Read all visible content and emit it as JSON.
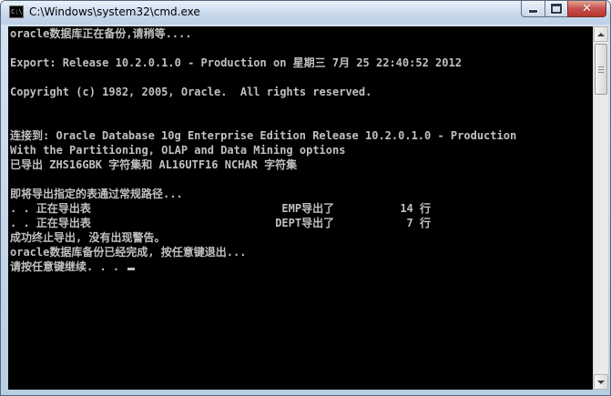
{
  "window": {
    "title": "C:\\Windows\\system32\\cmd.exe",
    "icon_text": "C:\\"
  },
  "console": {
    "lines": [
      "oracle数据库正在备份,请稍等....",
      "",
      "Export: Release 10.2.0.1.0 - Production on 星期三 7月 25 22:40:52 2012",
      "",
      "Copyright (c) 1982, 2005, Oracle.  All rights reserved.",
      "",
      "",
      "连接到: Oracle Database 10g Enterprise Edition Release 10.2.0.1.0 - Production",
      "With the Partitioning, OLAP and Data Mining options",
      "已导出 ZHS16GBK 字符集和 AL16UTF16 NCHAR 字符集",
      "",
      "即将导出指定的表通过常规路径...",
      ". . 正在导出表                             EMP导出了          14 行",
      ". . 正在导出表                            DEPT导出了           7 行",
      "成功终止导出, 没有出现警告。",
      "oracle数据库备份已经完成, 按任意键退出...",
      "请按任意键继续. . . "
    ]
  },
  "colors": {
    "console_bg": "#000000",
    "console_fg": "#c0c0c0",
    "close_button": "#c75050"
  },
  "icons": {
    "app": "cmd-icon",
    "minimize": "minimize-icon",
    "maximize": "maximize-icon",
    "close": "close-icon",
    "scroll_up": "scroll-up-arrow-icon",
    "scroll_down": "scroll-down-arrow-icon"
  }
}
